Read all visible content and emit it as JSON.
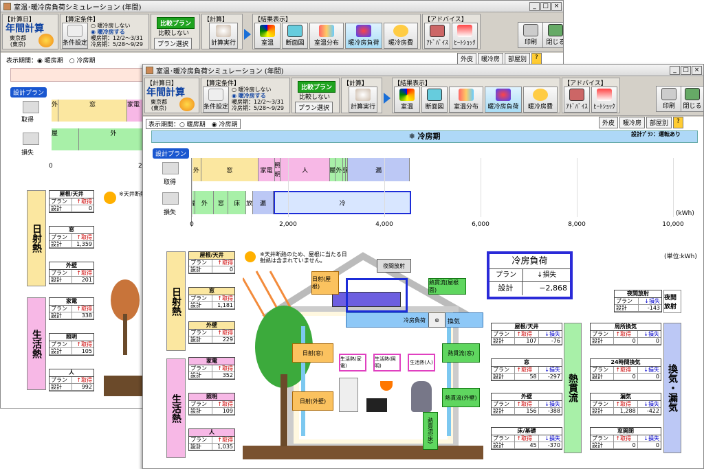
{
  "window_title": "室温･暖冷房負荷シミュレーション (年間)",
  "window_buttons": [
    "_",
    "□",
    "×"
  ],
  "toolbar": {
    "calc_day_label": "【計算日】",
    "calc_mode": "年間計算",
    "location": [
      "東京都",
      "(東京)"
    ],
    "cond_label": "【算定条件】",
    "cond_btn": "条件設定",
    "radio_none": "暖冷房しない",
    "radio_on": "暖冷房する",
    "heat_period": "暖房期：12/2～3/31",
    "cool_period": "冷房期：5/28～9/29",
    "compare_btn": "比較プラン",
    "compare_none": "比較しない",
    "plan_select": "プラン選択",
    "calc_group": "【計算】",
    "calc_exec": "計算実行",
    "result_group": "【結果表示】",
    "result_btns": [
      "室温",
      "断面図",
      "室温分布",
      "暖冷房負荷",
      "暖冷房費"
    ],
    "advice_group": "【アドバイス】",
    "advice_btns": [
      "ｱﾄﾞﾊﾞｲｽ",
      "ﾋｰﾄｼｮｯｸ"
    ],
    "print": "印刷",
    "close": "閉じる"
  },
  "view": {
    "period_label": "表示期間：",
    "heating": "暖房期",
    "cooling": "冷房期",
    "tabs": [
      "外皮",
      "暖冷房",
      "部屋別",
      "?"
    ]
  },
  "back": {
    "plan_badge": "設計プラン",
    "gain": "取得",
    "loss": "損失",
    "bar_gain": [
      "外",
      "窓",
      "家電"
    ],
    "bar_loss": [
      "屋",
      "外"
    ],
    "axis": [
      "0",
      "2"
    ],
    "solar_title": "日射熱",
    "life_title": "生活熱",
    "note": "※天井断熱のため… ",
    "tables": [
      {
        "title": "屋根/天井",
        "col2": "↑取得",
        "value": "0"
      },
      {
        "title": "窓",
        "col2": "↑取得",
        "value": "1,359"
      },
      {
        "title": "外壁",
        "col2": "↑取得",
        "value": "201"
      },
      {
        "title": "家電",
        "col2": "↑取得",
        "value": "338"
      },
      {
        "title": "照明",
        "col2": "↑取得",
        "value": "105"
      },
      {
        "title": "人",
        "col2": "↑取得",
        "value": "992"
      }
    ]
  },
  "front": {
    "banner": "冷房期",
    "plan_right": "設計ﾌﾟﾗﾝ：運転あり",
    "plan_badge": "設計プラン",
    "gain": "取得",
    "loss": "損失",
    "unit_kwh": "(kWh)",
    "unit_right": "(単位:kWh)",
    "note": "※天井断熱のため、屋根に当たる日射熱は含まれていません。",
    "solar_title": "日射熱",
    "life_title": "生活熱",
    "heat_flow_title": "熱貫流",
    "vent_title": "換気・漏気",
    "night_title": "夜間放射",
    "load_box": {
      "title": "冷房負荷",
      "h1": "プラン",
      "h2": "↓損失",
      "r1": "設計",
      "value": "−2,868"
    },
    "row_plan": "プラン",
    "row_design": "設計",
    "house_labels": {
      "night": "夜間放射",
      "roof_solar": "日射(屋根)",
      "heat_ceiling": "熱貫流(屋根面)",
      "cool_load": "冷房負荷",
      "vent": "換気",
      "sun_window": "日射(窓)",
      "sun_wall": "日射(外壁)",
      "heat_window": "熱貫流(窓)",
      "heat_wall": "熱貫流(外壁)",
      "heat_floor": "熱貫流(床)",
      "life1": "生活熱(家電)",
      "life2": "生活熱(照明)",
      "life3": "生活熱(人)"
    },
    "left_tables": [
      {
        "title": "屋根/天井",
        "c2": "↑取得",
        "v": "0"
      },
      {
        "title": "窓",
        "c2": "↑取得",
        "v": "1,181"
      },
      {
        "title": "外壁",
        "c2": "↑取得",
        "v": "229"
      },
      {
        "title": "家電",
        "c2": "↑取得",
        "v": "352"
      },
      {
        "title": "照明",
        "c2": "↑取得",
        "v": "109"
      },
      {
        "title": "人",
        "c2": "↑取得",
        "v": "1,035"
      }
    ],
    "flow_tables": [
      {
        "title": "屋根/天井",
        "v1": "107",
        "v2": "-76"
      },
      {
        "title": "窓",
        "v1": "58",
        "v2": "-297"
      },
      {
        "title": "外壁",
        "v1": "156",
        "v2": "-388"
      },
      {
        "title": "床/基礎",
        "v1": "45",
        "v2": "-370"
      }
    ],
    "vent_tables": [
      {
        "title": "局所換気",
        "v1": "0",
        "v2": "0"
      },
      {
        "title": "24時間換気",
        "v1": "0",
        "v2": "0"
      },
      {
        "title": "漏気",
        "v1": "1,288",
        "v2": "-422"
      },
      {
        "title": "窓開閉",
        "v1": "0",
        "v2": "0"
      }
    ],
    "night_table": {
      "title": "夜間放射",
      "c2": "↓損失",
      "v": "-143"
    },
    "col_gain": "↑取得",
    "col_loss": "↓損失"
  },
  "chart_data": {
    "type": "bar",
    "xlabel": "(kWh)",
    "xlim": [
      0,
      10000
    ],
    "ticks": [
      "0",
      "2,000",
      "4,000",
      "6,000",
      "8,000",
      "10,000"
    ],
    "series": [
      {
        "name": "取得",
        "segments": [
          {
            "label": "外",
            "value": 200,
            "color": "#fbe7a0"
          },
          {
            "label": "窓",
            "value": 1181,
            "color": "#fbe7a0"
          },
          {
            "label": "家電",
            "value": 352,
            "color": "#f7b8e6"
          },
          {
            "label": "照明",
            "value": 109,
            "color": "#f7b8e6"
          },
          {
            "label": "人",
            "value": 1035,
            "color": "#f7b8e6"
          },
          {
            "label": "屋",
            "value": 107,
            "color": "#a8f0a8"
          },
          {
            "label": "外",
            "value": 156,
            "color": "#a8f0a8"
          },
          {
            "label": "窓",
            "value": 58,
            "color": "#a8f0a8"
          },
          {
            "label": "床",
            "value": 45,
            "color": "#a8f0a8"
          },
          {
            "label": "漏",
            "value": 1288,
            "color": "#bcc8f5"
          }
        ]
      },
      {
        "name": "損失",
        "segments": [
          {
            "label": "屋",
            "value": 76,
            "color": "#a8f0a8"
          },
          {
            "label": "外",
            "value": 388,
            "color": "#a8f0a8"
          },
          {
            "label": "窓",
            "value": 297,
            "color": "#a8f0a8"
          },
          {
            "label": "床",
            "value": 370,
            "color": "#a8f0a8"
          },
          {
            "label": "放",
            "value": 143,
            "color": "#ffffff"
          },
          {
            "label": "漏",
            "value": 422,
            "color": "#bcc8f5"
          },
          {
            "label": "冷",
            "value": 2868,
            "color": "#d8e6ff"
          }
        ]
      }
    ]
  }
}
